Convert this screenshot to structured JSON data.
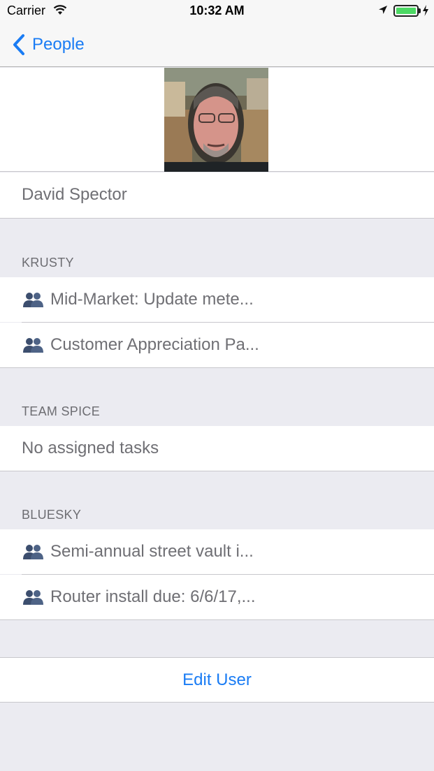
{
  "status_bar": {
    "carrier": "Carrier",
    "time": "10:32 AM",
    "battery_color": "#4cd964"
  },
  "nav": {
    "back_label": "People",
    "accent_color": "#1a7cf4"
  },
  "user": {
    "name": "David Spector",
    "avatar": "user-photo"
  },
  "sections": [
    {
      "header": "KRUSTY",
      "tasks": [
        {
          "icon": "group-icon",
          "title": "Mid-Market: Update mete..."
        },
        {
          "icon": "group-icon",
          "title": "Customer Appreciation Pa..."
        }
      ]
    },
    {
      "header": "TEAM SPICE",
      "empty_text": "No assigned tasks"
    },
    {
      "header": "BLUESKY",
      "tasks": [
        {
          "icon": "group-icon",
          "title": "Semi-annual street vault i..."
        },
        {
          "icon": "group-icon",
          "title": "Router install  due: 6/6/17,..."
        }
      ]
    }
  ],
  "actions": {
    "edit_user_label": "Edit User"
  }
}
